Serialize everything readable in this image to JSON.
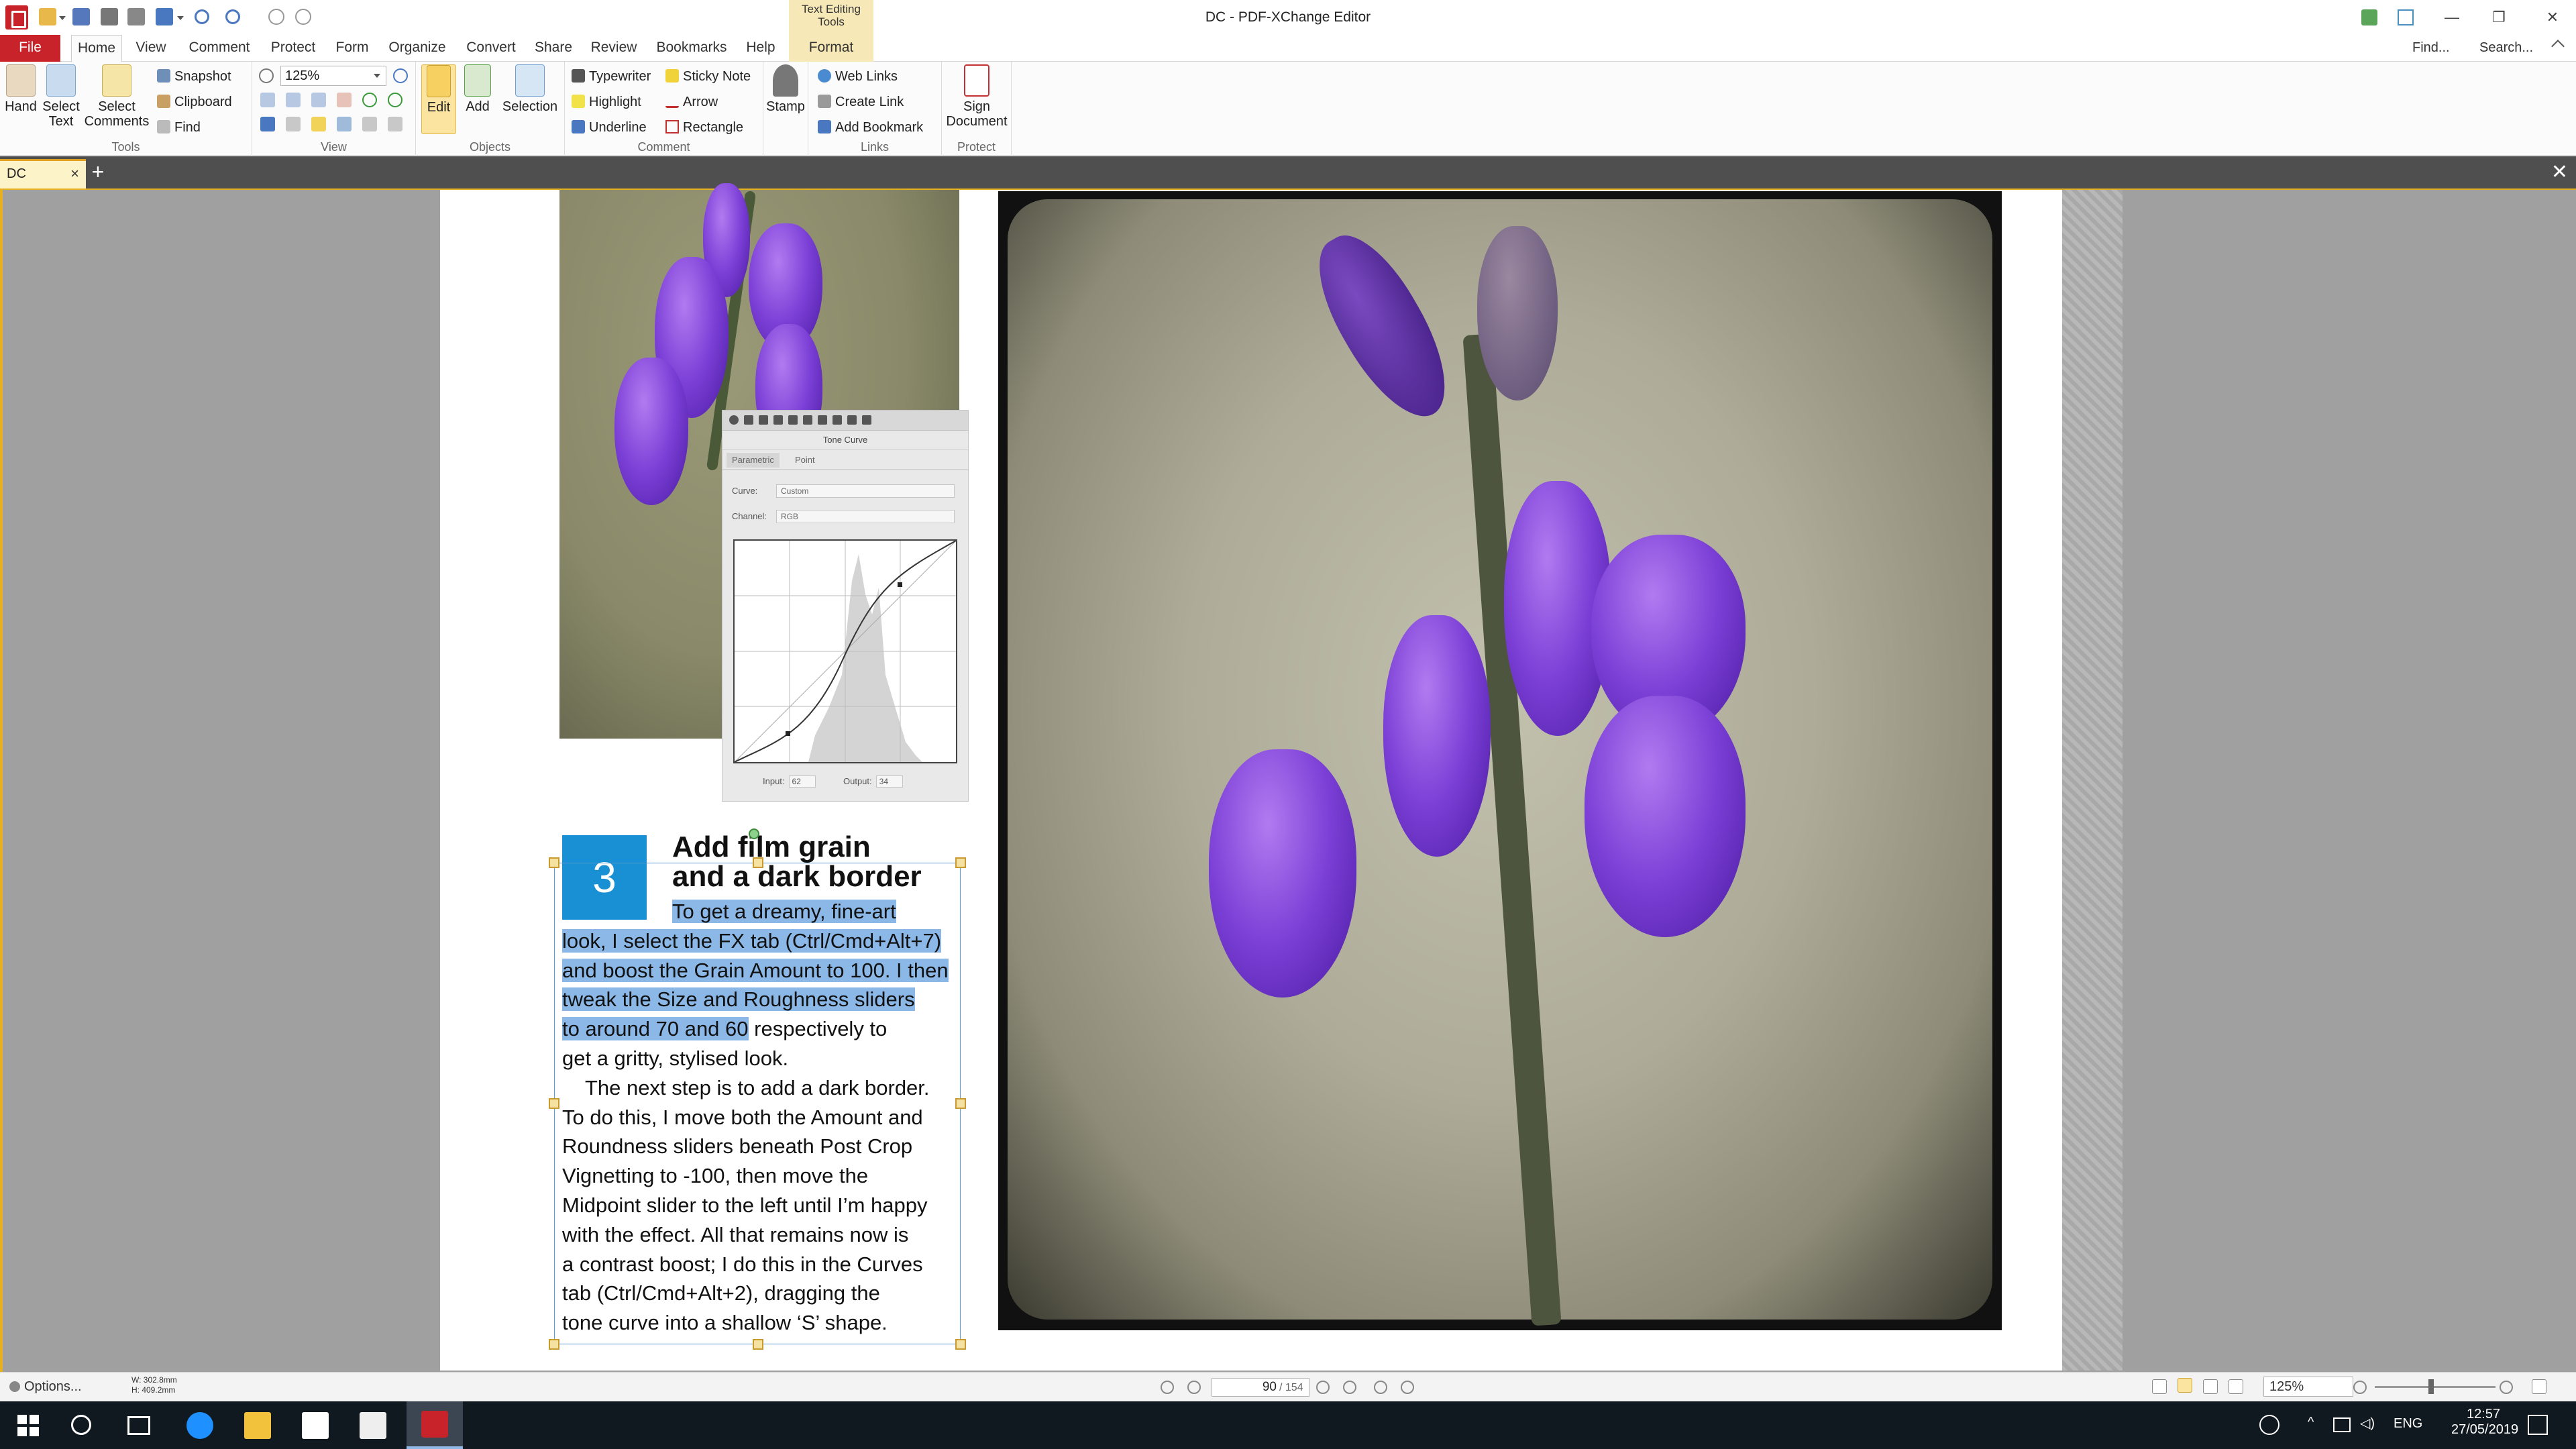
{
  "window": {
    "title": "DC - PDF-XChange Editor",
    "contextual_group": "Text Editing Tools"
  },
  "menu": {
    "file": "File",
    "tabs": [
      "Home",
      "View",
      "Comment",
      "Protect",
      "Form",
      "Organize",
      "Convert",
      "Share",
      "Review",
      "Bookmarks",
      "Help",
      "Format"
    ],
    "find": "Find...",
    "search": "Search..."
  },
  "ribbon": {
    "tools": {
      "label": "Tools",
      "hand": "Hand",
      "select_text": "Select Text",
      "select_comments": "Select Comments"
    },
    "view": {
      "label": "View",
      "snapshot": "Snapshot",
      "clipboard": "Clipboard",
      "find": "Find",
      "zoom": "125%"
    },
    "objects": {
      "label": "Objects",
      "edit": "Edit",
      "add": "Add",
      "selection": "Selection"
    },
    "comment": {
      "label": "Comment",
      "typewriter": "Typewriter",
      "sticky_note": "Sticky Note",
      "highlight": "Highlight",
      "arrow": "Arrow",
      "underline": "Underline",
      "rectangle": "Rectangle",
      "stamp": "Stamp"
    },
    "links": {
      "label": "Links",
      "web_links": "Web Links",
      "create_link": "Create Link",
      "add_bookmark": "Add Bookmark"
    },
    "protect": {
      "label": "Protect",
      "sign_document": "Sign Document"
    }
  },
  "document_tab": {
    "name": "DC"
  },
  "tone_curve": {
    "title": "Tone Curve",
    "tabs": [
      "Parametric",
      "Point"
    ],
    "curve_label": "Curve:",
    "curve_value": "Custom",
    "channel_label": "Channel:",
    "channel_value": "RGB",
    "input_label": "Input:",
    "input_value": "62",
    "output_label": "Output:",
    "output_value": "34"
  },
  "article": {
    "step": "3",
    "heading_line1": "Add film grain",
    "heading_line2": "and a dark border",
    "lines": [
      "To get a dreamy, fine-art",
      "look, I select the FX tab (Ctrl/Cmd+Alt+7)",
      "and boost the Grain Amount to 100. I then",
      "tweak the Size and Roughness sliders",
      "to around 70 and 60",
      " respectively to",
      "get a gritty, stylised look.",
      "The next step is to add a dark border.",
      "To do this, I move both the Amount and",
      "Roundness sliders beneath Post Crop",
      "Vignetting to -100, then move the",
      "Midpoint slider to the left until I’m happy",
      "with the effect. All that remains now is",
      "a contrast boost; I do this in the Curves",
      "tab (Ctrl/Cmd+Alt+2), dragging the",
      "tone curve into a shallow ‘S’ shape."
    ]
  },
  "statusbar": {
    "options": "Options...",
    "width": "W: 302.8mm",
    "height": "H: 409.2mm",
    "page_current": "90",
    "page_total": "/ 154",
    "zoom": "125%"
  },
  "taskbar": {
    "language": "ENG",
    "time": "12:57",
    "date": "27/05/2019"
  }
}
